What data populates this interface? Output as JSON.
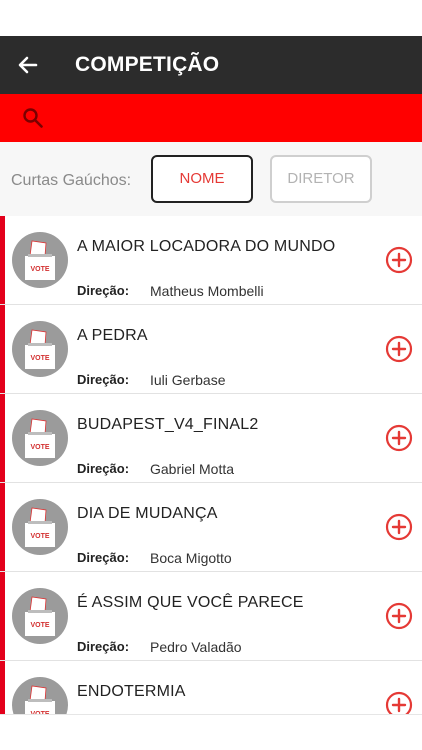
{
  "appbar": {
    "title": "COMPETIÇÃO"
  },
  "search": {
    "placeholder": ""
  },
  "filter": {
    "label": "Curtas Gaúchos:",
    "buttons": [
      {
        "label": "NOME",
        "selected": true
      },
      {
        "label": "DIRETOR",
        "selected": false
      }
    ]
  },
  "list": {
    "director_label": "Direção:",
    "avatar_text": "VOTE",
    "items": [
      {
        "title": "A MAIOR LOCADORA DO MUNDO",
        "director": "Matheus Mombelli"
      },
      {
        "title": "A PEDRA",
        "director": "Iuli Gerbase"
      },
      {
        "title": "BUDAPEST_V4_FINAL2",
        "director": "Gabriel Motta"
      },
      {
        "title": "DIA DE MUDANÇA",
        "director": "Boca Migotto"
      },
      {
        "title": "É ASSIM QUE VOCÊ PARECE",
        "director": "Pedro Valadão"
      },
      {
        "title": "ENDOTERMIA",
        "director": ""
      }
    ]
  },
  "icons": {
    "back": "arrow-left-icon",
    "search": "search-icon",
    "add": "plus-circle-icon",
    "avatar": "ballot-box-icon"
  },
  "colors": {
    "appbar": "#2c2c2c",
    "accent": "#ff0000",
    "item_bar": "#e3001b",
    "add_icon": "#e53935",
    "selected_border": "#222222"
  }
}
